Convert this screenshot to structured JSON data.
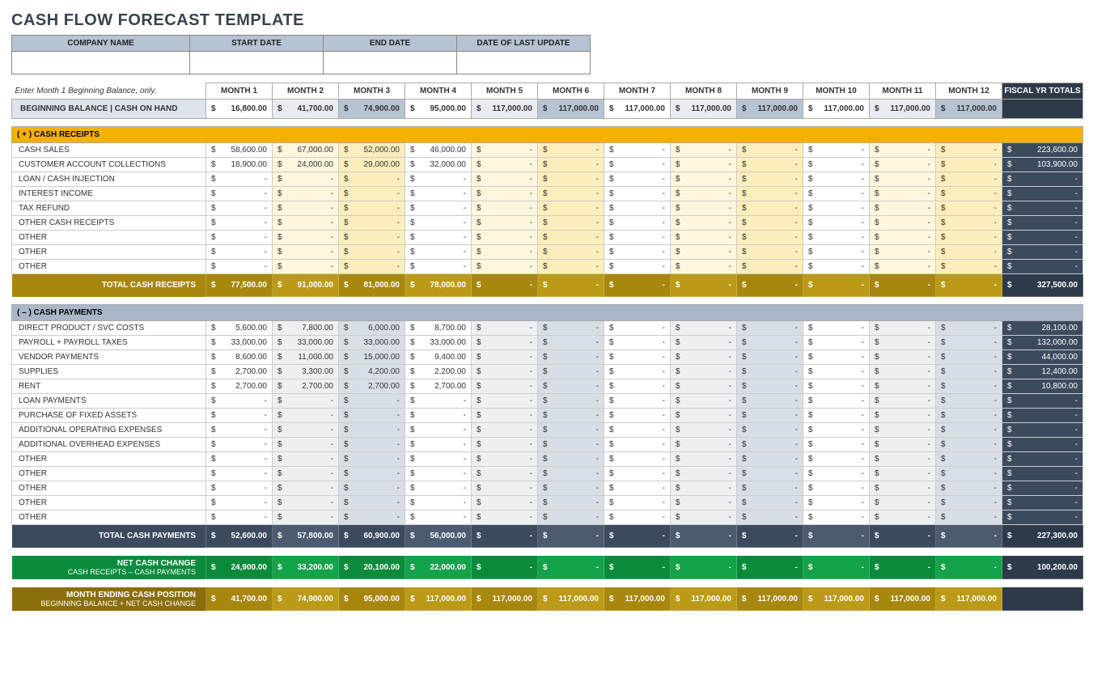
{
  "title": "CASH FLOW FORECAST TEMPLATE",
  "meta": {
    "headers": [
      "COMPANY NAME",
      "START DATE",
      "END DATE",
      "DATE OF LAST UPDATE"
    ],
    "values": [
      "",
      "",
      "",
      ""
    ]
  },
  "hint": "Enter Month 1 Beginning Balance, only.",
  "month_headers": [
    "MONTH 1",
    "MONTH 2",
    "MONTH 3",
    "MONTH 4",
    "MONTH 5",
    "MONTH 6",
    "MONTH 7",
    "MONTH 8",
    "MONTH 9",
    "MONTH 10",
    "MONTH 11",
    "MONTH 12"
  ],
  "fiscal_header": "FISCAL YR TOTALS",
  "currency": "$",
  "dash": "-",
  "beg_balance_label": "BEGINNING BALANCE  |  CASH ON HAND",
  "beg_balance": {
    "months": [
      "16,800.00",
      "41,700.00",
      "74,900.00",
      "95,000.00",
      "117,000.00",
      "117,000.00",
      "117,000.00",
      "117,000.00",
      "117,000.00",
      "117,000.00",
      "117,000.00",
      "117,000.00"
    ],
    "total": ""
  },
  "receipts_header": "(  + )   CASH RECEIPTS",
  "receipts": [
    {
      "label": "CASH SALES",
      "months": [
        "58,600.00",
        "67,000.00",
        "52,000.00",
        "46,000.00",
        "-",
        "-",
        "-",
        "-",
        "-",
        "-",
        "-",
        "-"
      ],
      "total": "223,600.00"
    },
    {
      "label": "CUSTOMER ACCOUNT COLLECTIONS",
      "months": [
        "18,900.00",
        "24,000.00",
        "29,000.00",
        "32,000.00",
        "-",
        "-",
        "-",
        "-",
        "-",
        "-",
        "-",
        "-"
      ],
      "total": "103,900.00"
    },
    {
      "label": "LOAN / CASH INJECTION",
      "months": [
        "-",
        "-",
        "-",
        "-",
        "-",
        "-",
        "-",
        "-",
        "-",
        "-",
        "-",
        "-"
      ],
      "total": "-"
    },
    {
      "label": "INTEREST INCOME",
      "months": [
        "-",
        "-",
        "-",
        "-",
        "-",
        "-",
        "-",
        "-",
        "-",
        "-",
        "-",
        "-"
      ],
      "total": "-"
    },
    {
      "label": "TAX REFUND",
      "months": [
        "-",
        "-",
        "-",
        "-",
        "-",
        "-",
        "-",
        "-",
        "-",
        "-",
        "-",
        "-"
      ],
      "total": "-"
    },
    {
      "label": "OTHER CASH RECEIPTS",
      "months": [
        "-",
        "-",
        "-",
        "-",
        "-",
        "-",
        "-",
        "-",
        "-",
        "-",
        "-",
        "-"
      ],
      "total": "-"
    },
    {
      "label": "OTHER",
      "months": [
        "-",
        "-",
        "-",
        "-",
        "-",
        "-",
        "-",
        "-",
        "-",
        "-",
        "-",
        "-"
      ],
      "total": "-"
    },
    {
      "label": "OTHER",
      "months": [
        "-",
        "-",
        "-",
        "-",
        "-",
        "-",
        "-",
        "-",
        "-",
        "-",
        "-",
        "-"
      ],
      "total": "-"
    },
    {
      "label": "OTHER",
      "months": [
        "-",
        "-",
        "-",
        "-",
        "-",
        "-",
        "-",
        "-",
        "-",
        "-",
        "-",
        "-"
      ],
      "total": "-"
    }
  ],
  "receipts_total_label": "TOTAL CASH RECEIPTS",
  "receipts_total": {
    "months": [
      "77,500.00",
      "91,000.00",
      "81,000.00",
      "78,000.00",
      "-",
      "-",
      "-",
      "-",
      "-",
      "-",
      "-",
      "-"
    ],
    "total": "327,500.00"
  },
  "payments_header": "(  – )   CASH PAYMENTS",
  "payments": [
    {
      "label": "DIRECT PRODUCT / SVC COSTS",
      "months": [
        "5,600.00",
        "7,800.00",
        "6,000.00",
        "8,700.00",
        "-",
        "-",
        "-",
        "-",
        "-",
        "-",
        "-",
        "-"
      ],
      "total": "28,100.00"
    },
    {
      "label": "PAYROLL + PAYROLL TAXES",
      "months": [
        "33,000.00",
        "33,000.00",
        "33,000.00",
        "33,000.00",
        "-",
        "-",
        "-",
        "-",
        "-",
        "-",
        "-",
        "-"
      ],
      "total": "132,000.00"
    },
    {
      "label": "VENDOR PAYMENTS",
      "months": [
        "8,600.00",
        "11,000.00",
        "15,000.00",
        "9,400.00",
        "-",
        "-",
        "-",
        "-",
        "-",
        "-",
        "-",
        "-"
      ],
      "total": "44,000.00"
    },
    {
      "label": "SUPPLIES",
      "months": [
        "2,700.00",
        "3,300.00",
        "4,200.00",
        "2,200.00",
        "-",
        "-",
        "-",
        "-",
        "-",
        "-",
        "-",
        "-"
      ],
      "total": "12,400.00"
    },
    {
      "label": "RENT",
      "months": [
        "2,700.00",
        "2,700.00",
        "2,700.00",
        "2,700.00",
        "-",
        "-",
        "-",
        "-",
        "-",
        "-",
        "-",
        "-"
      ],
      "total": "10,800.00"
    },
    {
      "label": "LOAN PAYMENTS",
      "months": [
        "-",
        "-",
        "-",
        "-",
        "-",
        "-",
        "-",
        "-",
        "-",
        "-",
        "-",
        "-"
      ],
      "total": "-"
    },
    {
      "label": "PURCHASE OF FIXED ASSETS",
      "months": [
        "-",
        "-",
        "-",
        "-",
        "-",
        "-",
        "-",
        "-",
        "-",
        "-",
        "-",
        "-"
      ],
      "total": "-"
    },
    {
      "label": "ADDITIONAL OPERATING EXPENSES",
      "months": [
        "-",
        "-",
        "-",
        "-",
        "-",
        "-",
        "-",
        "-",
        "-",
        "-",
        "-",
        "-"
      ],
      "total": "-"
    },
    {
      "label": "ADDITIONAL OVERHEAD EXPENSES",
      "months": [
        "-",
        "-",
        "-",
        "-",
        "-",
        "-",
        "-",
        "-",
        "-",
        "-",
        "-",
        "-"
      ],
      "total": "-"
    },
    {
      "label": "OTHER",
      "months": [
        "-",
        "-",
        "-",
        "-",
        "-",
        "-",
        "-",
        "-",
        "-",
        "-",
        "-",
        "-"
      ],
      "total": "-"
    },
    {
      "label": "OTHER",
      "months": [
        "-",
        "-",
        "-",
        "-",
        "-",
        "-",
        "-",
        "-",
        "-",
        "-",
        "-",
        "-"
      ],
      "total": "-"
    },
    {
      "label": "OTHER",
      "months": [
        "-",
        "-",
        "-",
        "-",
        "-",
        "-",
        "-",
        "-",
        "-",
        "-",
        "-",
        "-"
      ],
      "total": "-"
    },
    {
      "label": "OTHER",
      "months": [
        "-",
        "-",
        "-",
        "-",
        "-",
        "-",
        "-",
        "-",
        "-",
        "-",
        "-",
        "-"
      ],
      "total": "-"
    },
    {
      "label": "OTHER",
      "months": [
        "-",
        "-",
        "-",
        "-",
        "-",
        "-",
        "-",
        "-",
        "-",
        "-",
        "-",
        "-"
      ],
      "total": "-"
    }
  ],
  "payments_total_label": "TOTAL CASH PAYMENTS",
  "payments_total": {
    "months": [
      "52,600.00",
      "57,800.00",
      "60,900.00",
      "56,000.00",
      "-",
      "-",
      "-",
      "-",
      "-",
      "-",
      "-",
      "-"
    ],
    "total": "227,300.00"
  },
  "net_label": "NET CASH CHANGE",
  "net_sub": "CASH RECEIPTS – CASH PAYMENTS",
  "net": {
    "months": [
      "24,900.00",
      "33,200.00",
      "20,100.00",
      "22,000.00",
      "-",
      "-",
      "-",
      "-",
      "-",
      "-",
      "-",
      "-"
    ],
    "total": "100,200.00"
  },
  "end_label": "MONTH ENDING CASH POSITION",
  "end_sub": "BEGINNING BALANCE + NET CASH CHANGE",
  "end": {
    "months": [
      "41,700.00",
      "74,900.00",
      "95,000.00",
      "117,000.00",
      "117,000.00",
      "117,000.00",
      "117,000.00",
      "117,000.00",
      "117,000.00",
      "117,000.00",
      "117,000.00",
      "117,000.00"
    ],
    "total": ""
  }
}
